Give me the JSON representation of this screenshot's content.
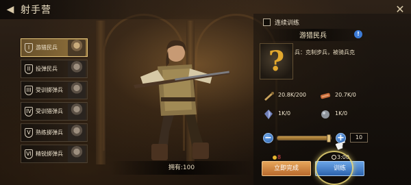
{
  "header": {
    "title": "射手营",
    "back_icon": "back-icon",
    "close_icon": "close-icon"
  },
  "units": [
    {
      "label": "游猎民兵",
      "icon": "shield-icon",
      "selected": true
    },
    {
      "label": "投弹民兵",
      "icon": "shield-icon",
      "selected": false
    },
    {
      "label": "受训掷弹兵",
      "icon": "shield-icon",
      "selected": false
    },
    {
      "label": "受训猎弹兵",
      "icon": "shield-icon",
      "selected": false
    },
    {
      "label": "熟练掷弹兵",
      "icon": "shield-icon",
      "selected": false
    },
    {
      "label": "精锐掷弹兵",
      "icon": "shield-icon",
      "selected": false
    }
  ],
  "owned": "拥有:100",
  "detail": {
    "continuous_training_label": "连续训练",
    "continuous_training_checked": false,
    "unit_name": "游猎民兵",
    "description": "兵：克制步兵，被骑兵克",
    "mystery_symbol": "?"
  },
  "resources": [
    {
      "icon": "wood-icon",
      "value": "20.8K/200"
    },
    {
      "icon": "meat-icon",
      "value": "20.7K/0"
    },
    {
      "icon": "crystal-icon",
      "value": "1K/0"
    },
    {
      "icon": "stone-icon",
      "value": "1K/0"
    }
  ],
  "quantity": {
    "value": "10",
    "slider_fraction": 0.98
  },
  "costs": {
    "gold": "8",
    "time": "3:00"
  },
  "buttons": {
    "instant": "立即完成",
    "train": "训练"
  },
  "colors": {
    "gold_accent": "#e2a82e",
    "instant_button": "#d9893f",
    "train_button": "#4a86d0",
    "insufficient_red": "#e0484c"
  }
}
